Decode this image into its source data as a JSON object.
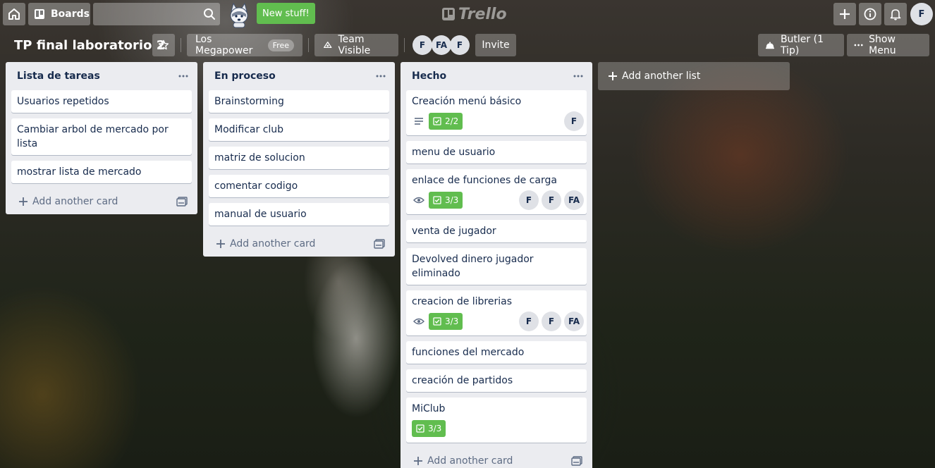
{
  "header": {
    "boards_label": "Boards",
    "search_value": "",
    "new_stuff_label": "New stuff!",
    "logo_text": "Trello",
    "user_initial": "F"
  },
  "board": {
    "title": "TP final laboratorio 2",
    "team_name": "Los Megapower",
    "team_badge": "Free",
    "visibility_label": "Team Visible",
    "members": [
      "F",
      "FA",
      "F"
    ],
    "invite_label": "Invite",
    "butler_label": "Butler (1 Tip)",
    "show_menu_label": "Show Menu"
  },
  "lists": [
    {
      "title": "Lista de tareas",
      "add_card_label": "Add another card",
      "cards": [
        {
          "title": "Usuarios repetidos"
        },
        {
          "title": "Cambiar arbol de mercado por lista"
        },
        {
          "title": "mostrar lista de mercado"
        }
      ]
    },
    {
      "title": "En proceso",
      "add_card_label": "Add another card",
      "cards": [
        {
          "title": "Brainstorming"
        },
        {
          "title": "Modificar club"
        },
        {
          "title": "matriz de solucion"
        },
        {
          "title": "comentar codigo"
        },
        {
          "title": "manual de usuario"
        }
      ]
    },
    {
      "title": "Hecho",
      "add_card_label": "Add another card",
      "cards": [
        {
          "title": "Creación menú básico",
          "checklist": "2/2",
          "description": true,
          "members": [
            "F"
          ]
        },
        {
          "title": "menu de usuario"
        },
        {
          "title": "enlace de funciones de carga",
          "checklist": "3/3",
          "watching": true,
          "members": [
            "F",
            "F",
            "FA"
          ]
        },
        {
          "title": "venta de jugador"
        },
        {
          "title": "Devolved dinero jugador eliminado"
        },
        {
          "title": "creacion de librerias",
          "checklist": "3/3",
          "watching": true,
          "members": [
            "F",
            "F",
            "FA"
          ]
        },
        {
          "title": "funciones del mercado"
        },
        {
          "title": "creación de partidos"
        },
        {
          "title": "MiClub",
          "checklist": "3/3"
        }
      ]
    }
  ],
  "add_list_label": "Add another list",
  "colors": {
    "list_bg": "#ebecf0",
    "checklist_complete": "#61bd4f",
    "text": "#172b4d"
  }
}
